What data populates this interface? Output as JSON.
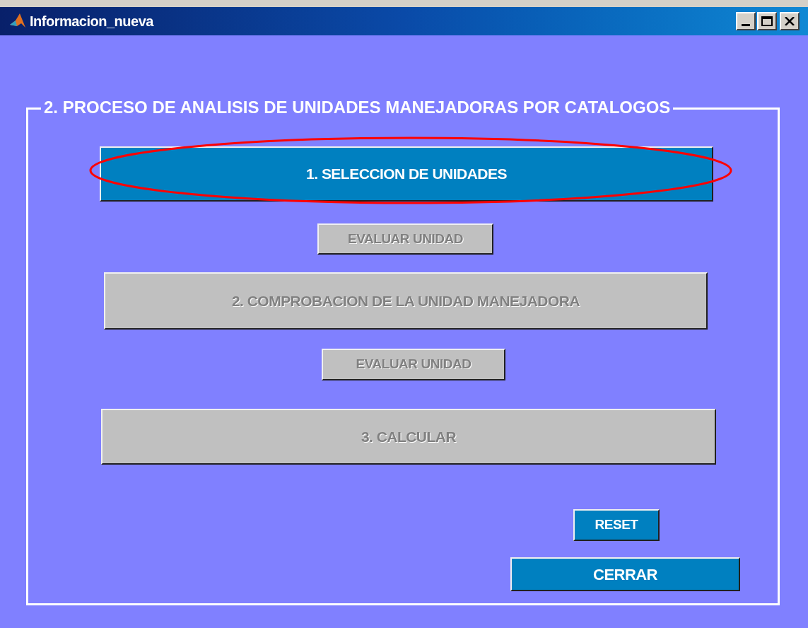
{
  "window": {
    "title": "Informacion_nueva"
  },
  "panel": {
    "title": "2. PROCESO DE ANALISIS DE UNIDADES MANEJADORAS POR CATALOGOS"
  },
  "buttons": [
    {
      "label": "1. SELECCION DE UNIDADES",
      "disabled": false,
      "circled": true
    },
    {
      "label": "EVALUAR UNIDAD",
      "disabled": true,
      "circled": false
    },
    {
      "label": "2. COMPROBACION DE LA UNIDAD MANEJADORA",
      "disabled": true,
      "circled": false
    },
    {
      "label": "EVALUAR UNIDAD",
      "disabled": true,
      "circled": false
    },
    {
      "label": "3. CALCULAR",
      "disabled": true,
      "circled": false
    },
    {
      "label": "RESET",
      "disabled": false,
      "circled": false
    },
    {
      "label": "CERRAR",
      "disabled": false,
      "circled": false
    }
  ]
}
